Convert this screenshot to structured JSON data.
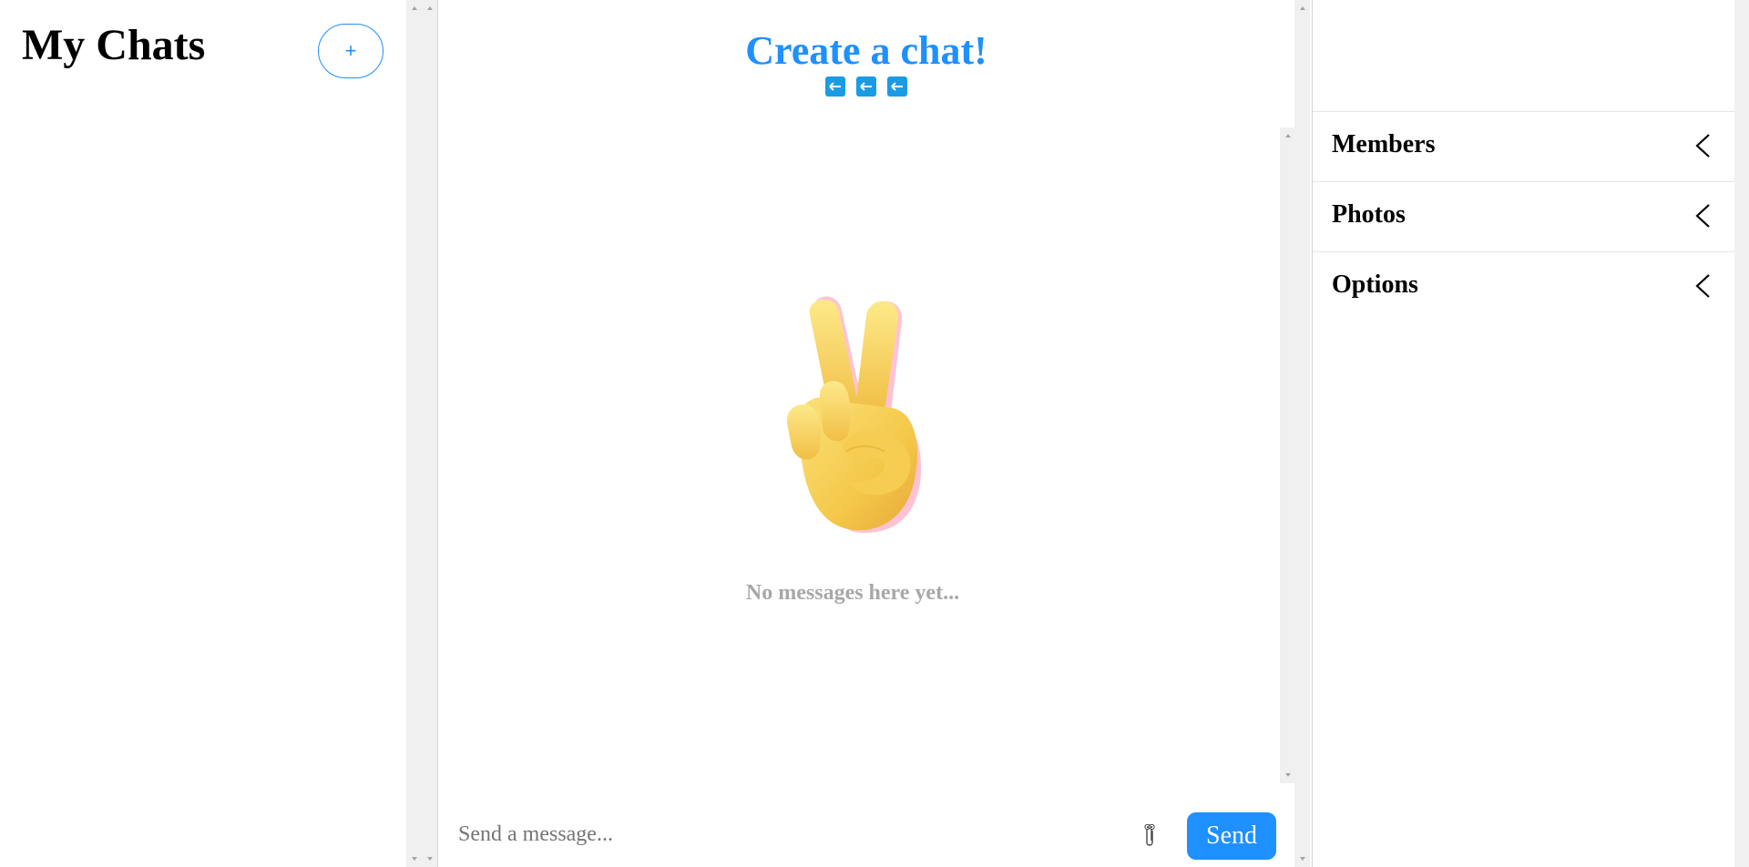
{
  "sidebar": {
    "title": "My Chats",
    "new_chat_label": "+"
  },
  "chat": {
    "title": "Create a chat!",
    "nav_icons": [
      "arrow-left-icon",
      "arrow-left-icon",
      "arrow-left-icon"
    ],
    "empty_state_icon": "victory-hand-emoji",
    "empty_message": "No messages here yet...",
    "input_placeholder": "Send a message...",
    "input_value": "",
    "attach_icon": "paperclip-icon",
    "send_label": "Send"
  },
  "details_panel": {
    "sections": [
      {
        "label": "Members",
        "icon": "chevron-left-icon"
      },
      {
        "label": "Photos",
        "icon": "chevron-left-icon"
      },
      {
        "label": "Options",
        "icon": "chevron-left-icon"
      }
    ]
  },
  "colors": {
    "accent": "#1e90ff",
    "nav_arrow": "#1a9be6",
    "muted_text": "#a8a8a8",
    "scrollbar": "#f0f0f0"
  }
}
